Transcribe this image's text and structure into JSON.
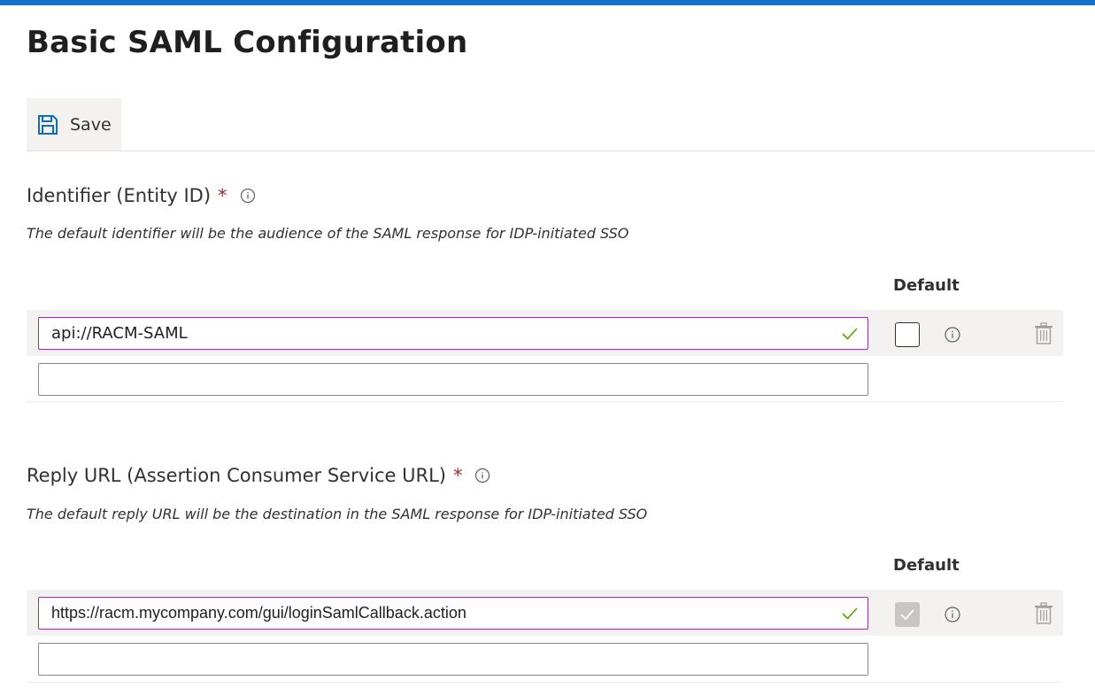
{
  "page": {
    "title": "Basic SAML Configuration"
  },
  "toolbar": {
    "save_label": "Save",
    "save_icon": "save-icon"
  },
  "identifier": {
    "label": "Identifier (Entity ID)",
    "required_mark": "*",
    "description": "The default identifier will be the audience of the SAML response for IDP-initiated SSO",
    "default_header": "Default",
    "rows": [
      {
        "value": "api://RACM-SAML",
        "valid": true,
        "default_checked": false,
        "default_disabled": false
      },
      {
        "value": ""
      }
    ]
  },
  "reply_url": {
    "label": "Reply URL (Assertion Consumer Service URL)",
    "required_mark": "*",
    "description": "The default reply URL will be the destination in the SAML response for IDP-initiated SSO",
    "default_header": "Default",
    "rows": [
      {
        "value": "https://racm.mycompany.com/gui/loginSamlCallback.action",
        "valid": true,
        "default_checked": true,
        "default_disabled": true
      },
      {
        "value": ""
      }
    ]
  },
  "colors": {
    "accent": "#1170cf",
    "required": "#a4262c",
    "input_focus_border": "#8d3a9c",
    "valid_check": "#57a300"
  }
}
